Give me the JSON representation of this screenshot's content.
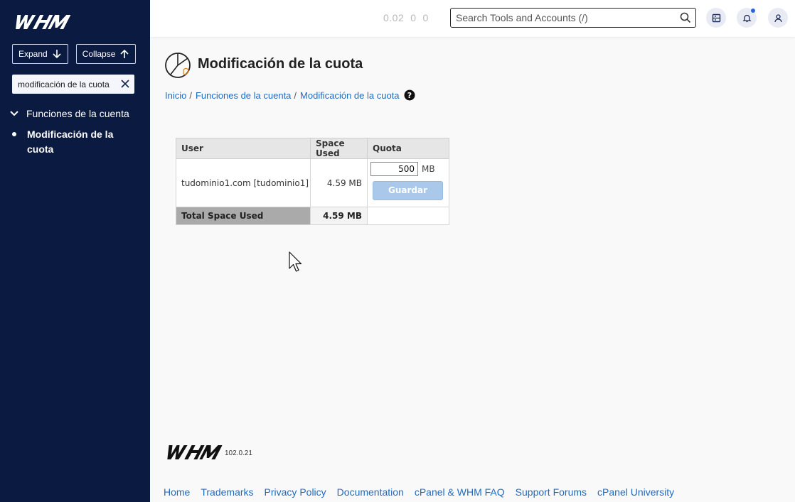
{
  "sidebar": {
    "logo_text": "WHM",
    "expand_label": "Expand",
    "collapse_label": "Collapse",
    "filter_value": "modificación de la cuota",
    "group_label": "Funciones de la cuenta",
    "active_item": "Modificación de la cuota"
  },
  "topbar": {
    "load": [
      "0.02",
      "0",
      "0"
    ],
    "search_placeholder": "Search Tools and Accounts (/)",
    "icons": [
      "server-icon",
      "bell-icon",
      "user-icon"
    ],
    "notification_color": "#2a67d6"
  },
  "page": {
    "title": "Modificación de la cuota",
    "breadcrumbs": [
      "Inicio",
      "Funciones de la cuenta",
      "Modificación de la cuota"
    ]
  },
  "table": {
    "headers": [
      "User",
      "Space Used",
      "Quota"
    ],
    "rows": [
      {
        "user": "tudominio1.com [tudominio1]",
        "space_used": "4.59 MB",
        "quota_value": "500",
        "quota_unit": "MB",
        "save_label": "Guardar"
      }
    ],
    "total_label": "Total Space Used",
    "total_space": "4.59 MB"
  },
  "footer": {
    "version": "102.0.21",
    "links": [
      "Home",
      "Trademarks",
      "Privacy Policy",
      "Documentation",
      "cPanel & WHM FAQ",
      "Support Forums",
      "cPanel University"
    ]
  },
  "colors": {
    "sidebar_bg": "#0b1a40",
    "link": "#1f6bc1",
    "save_button": "#a9c8ea"
  }
}
